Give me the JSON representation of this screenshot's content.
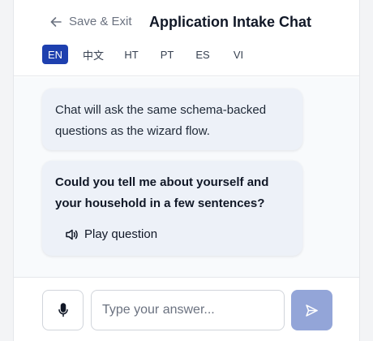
{
  "header": {
    "back_label": "Save & Exit",
    "back_icon": "arrow-left-icon",
    "title": "Application Intake Chat"
  },
  "languages": [
    {
      "code": "EN",
      "active": true
    },
    {
      "code": "中文",
      "active": false
    },
    {
      "code": "HT",
      "active": false
    },
    {
      "code": "PT",
      "active": false
    },
    {
      "code": "ES",
      "active": false
    },
    {
      "code": "VI",
      "active": false
    }
  ],
  "messages": {
    "info": "Chat will ask the same schema-backed questions as the wizard flow.",
    "question": "Could you tell me about yourself and your household in a few sentences?",
    "play_label": "Play question",
    "play_icon": "speaker-icon"
  },
  "composer": {
    "placeholder": "Type your answer...",
    "value": "",
    "mic_icon": "microphone-icon",
    "send_icon": "send-icon"
  },
  "colors": {
    "accent": "#1e40af",
    "send_button": "#93a5d8",
    "bubble": "#edf1f8"
  }
}
